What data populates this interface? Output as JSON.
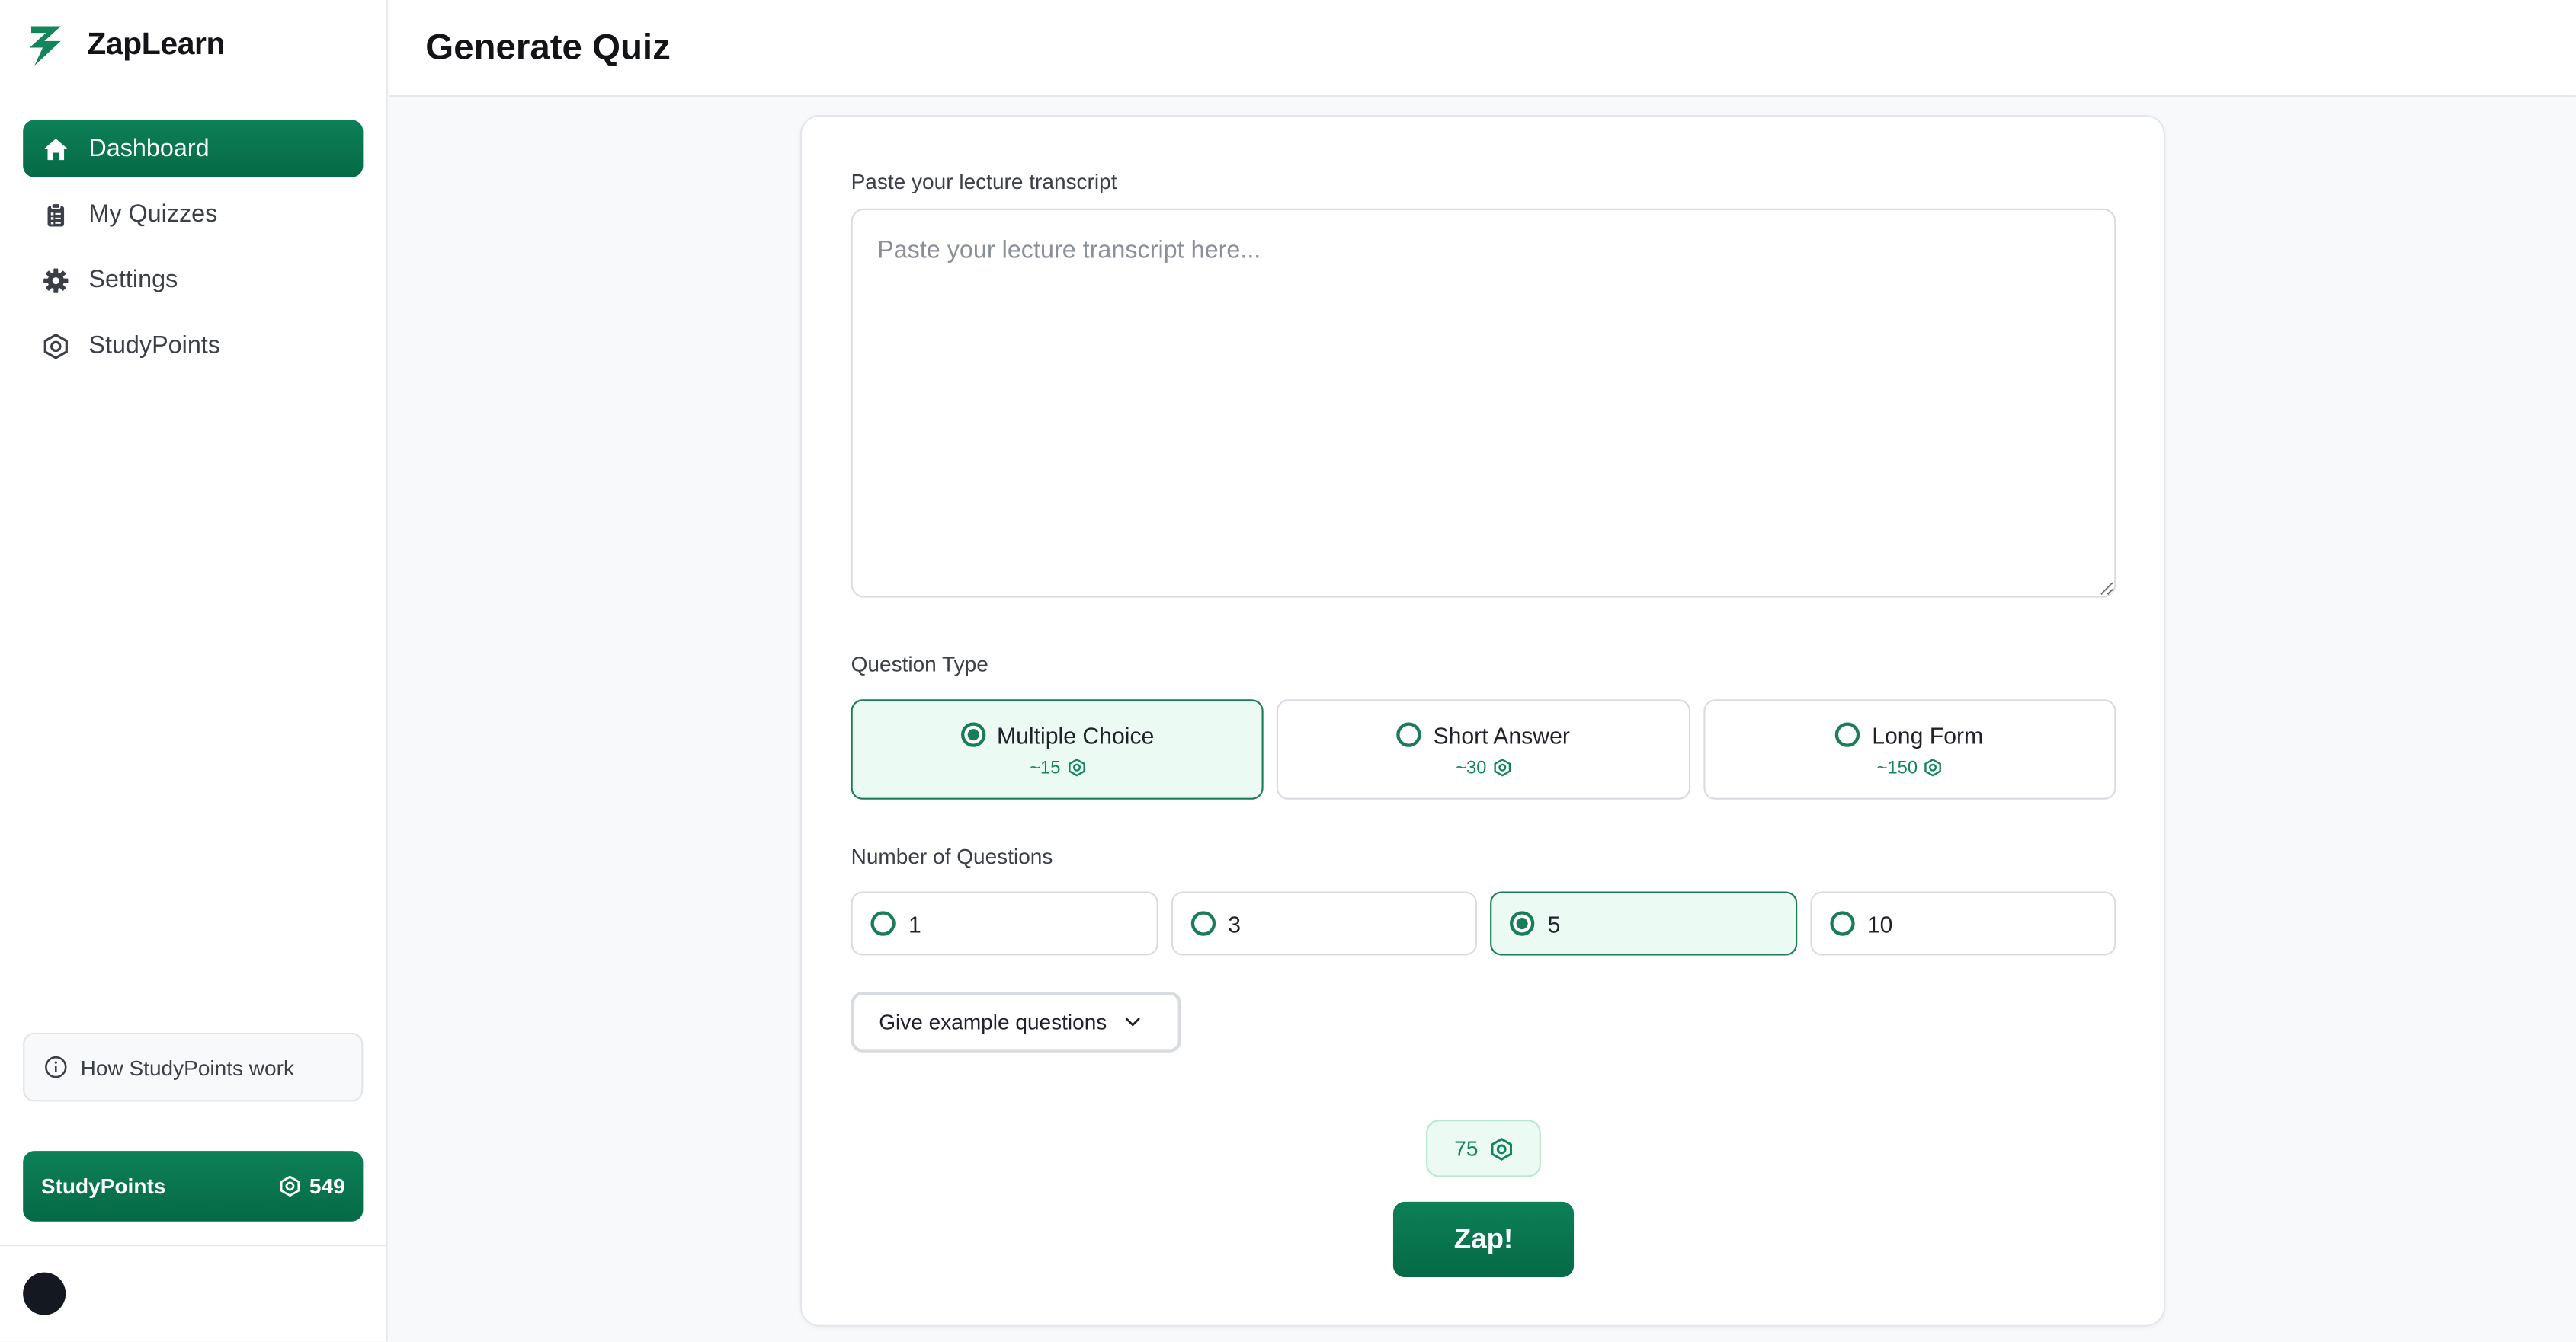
{
  "app": {
    "name": "ZapLearn",
    "brand_color": "#0d7a52"
  },
  "sidebar": {
    "items": [
      {
        "label": "Dashboard",
        "icon": "home-icon",
        "active": true
      },
      {
        "label": "My Quizzes",
        "icon": "clipboard-icon",
        "active": false
      },
      {
        "label": "Settings",
        "icon": "gear-icon",
        "active": false
      },
      {
        "label": "StudyPoints",
        "icon": "hexagon-icon",
        "active": false
      }
    ],
    "how_label": "How StudyPoints work",
    "studypoints": {
      "label": "StudyPoints",
      "value": "549"
    }
  },
  "header": {
    "title": "Generate Quiz"
  },
  "form": {
    "transcript_label": "Paste your lecture transcript",
    "transcript_placeholder": "Paste your lecture transcript here...",
    "transcript_value": "",
    "question_type_label": "Question Type",
    "question_types": [
      {
        "label": "Multiple Choice",
        "cost": "~15",
        "selected": true
      },
      {
        "label": "Short Answer",
        "cost": "~30",
        "selected": false
      },
      {
        "label": "Long Form",
        "cost": "~150",
        "selected": false
      }
    ],
    "num_questions_label": "Number of Questions",
    "num_questions": [
      {
        "label": "1",
        "selected": false
      },
      {
        "label": "3",
        "selected": false
      },
      {
        "label": "5",
        "selected": true
      },
      {
        "label": "10",
        "selected": false
      }
    ],
    "examples_label": "Give example questions",
    "cost_total": "75",
    "submit_label": "Zap!"
  }
}
